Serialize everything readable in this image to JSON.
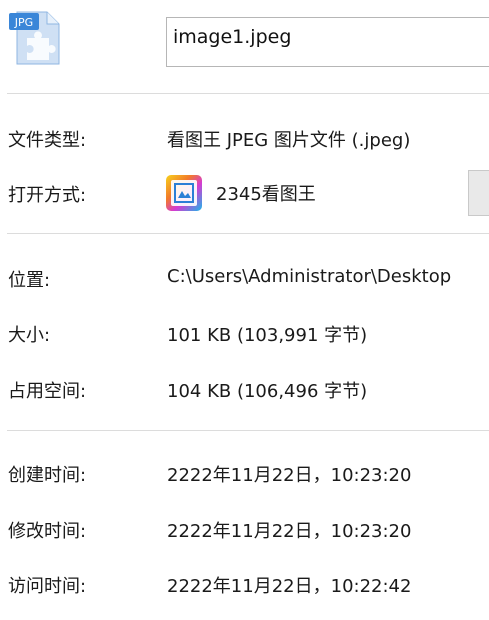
{
  "header": {
    "file_icon": "jpeg-file-icon",
    "file_icon_badge": "JPG",
    "file_name": "image1.jpeg"
  },
  "details": {
    "file_type": {
      "label": "文件类型:",
      "value": "看图王 JPEG 图片文件 (.jpeg)"
    },
    "opens_with": {
      "label": "打开方式:",
      "app_icon": "2345-picture-viewer-icon",
      "app_name": "2345看图王"
    },
    "location": {
      "label": "位置:",
      "value": "C:\\Users\\Administrator\\Desktop"
    },
    "size": {
      "label": "大小:",
      "value": "101 KB (103,991 字节)"
    },
    "size_on_disk": {
      "label": "占用空间:",
      "value": "104 KB (106,496 字节)"
    },
    "created": {
      "label": "创建时间:",
      "value": "2222年11月22日，10:23:20"
    },
    "modified": {
      "label": "修改时间:",
      "value": "2222年11月22日，10:23:20"
    },
    "accessed": {
      "label": "访问时间:",
      "value": "2222年11月22日，10:22:42"
    }
  },
  "colors": {
    "separator": "#dcdcdc",
    "field_border": "#b6b6b6",
    "icon_blue": "#3a86d8",
    "icon_light": "#cfe0f4"
  }
}
